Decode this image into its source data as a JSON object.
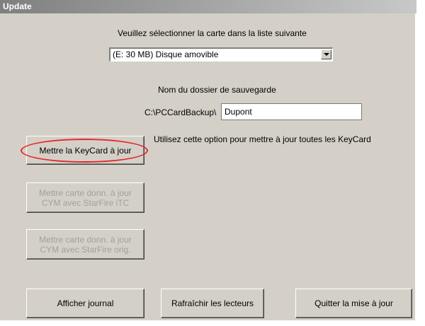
{
  "window": {
    "title": "Update"
  },
  "card_select": {
    "label": "Veuillez sélectionner la carte dans la liste suivante",
    "selected": "(E: 30 MB) Disque amovible"
  },
  "backup": {
    "label": "Nom du dossier de sauvegarde",
    "path_prefix": "C:\\PCCardBackup\\",
    "folder_value": "Dupont"
  },
  "buttons": {
    "update_keycard": "Mettre la KeyCard à jour",
    "update_keycard_hint": "Utilisez cette option pour mettre à jour toutes les KeyCard",
    "update_cym_itc": "Mettre carte donn. à jour\nCYM avec StarFire iTC",
    "update_cym_orig": "Mettre carte donn. à jour\nCYM avec StarFire orig.",
    "show_log": "Afficher journal",
    "refresh_drives": "Rafraîchir les lecteurs",
    "quit_update": "Quitter la mise à jour"
  },
  "annotation": {
    "highlight_color": "#e8262e"
  }
}
